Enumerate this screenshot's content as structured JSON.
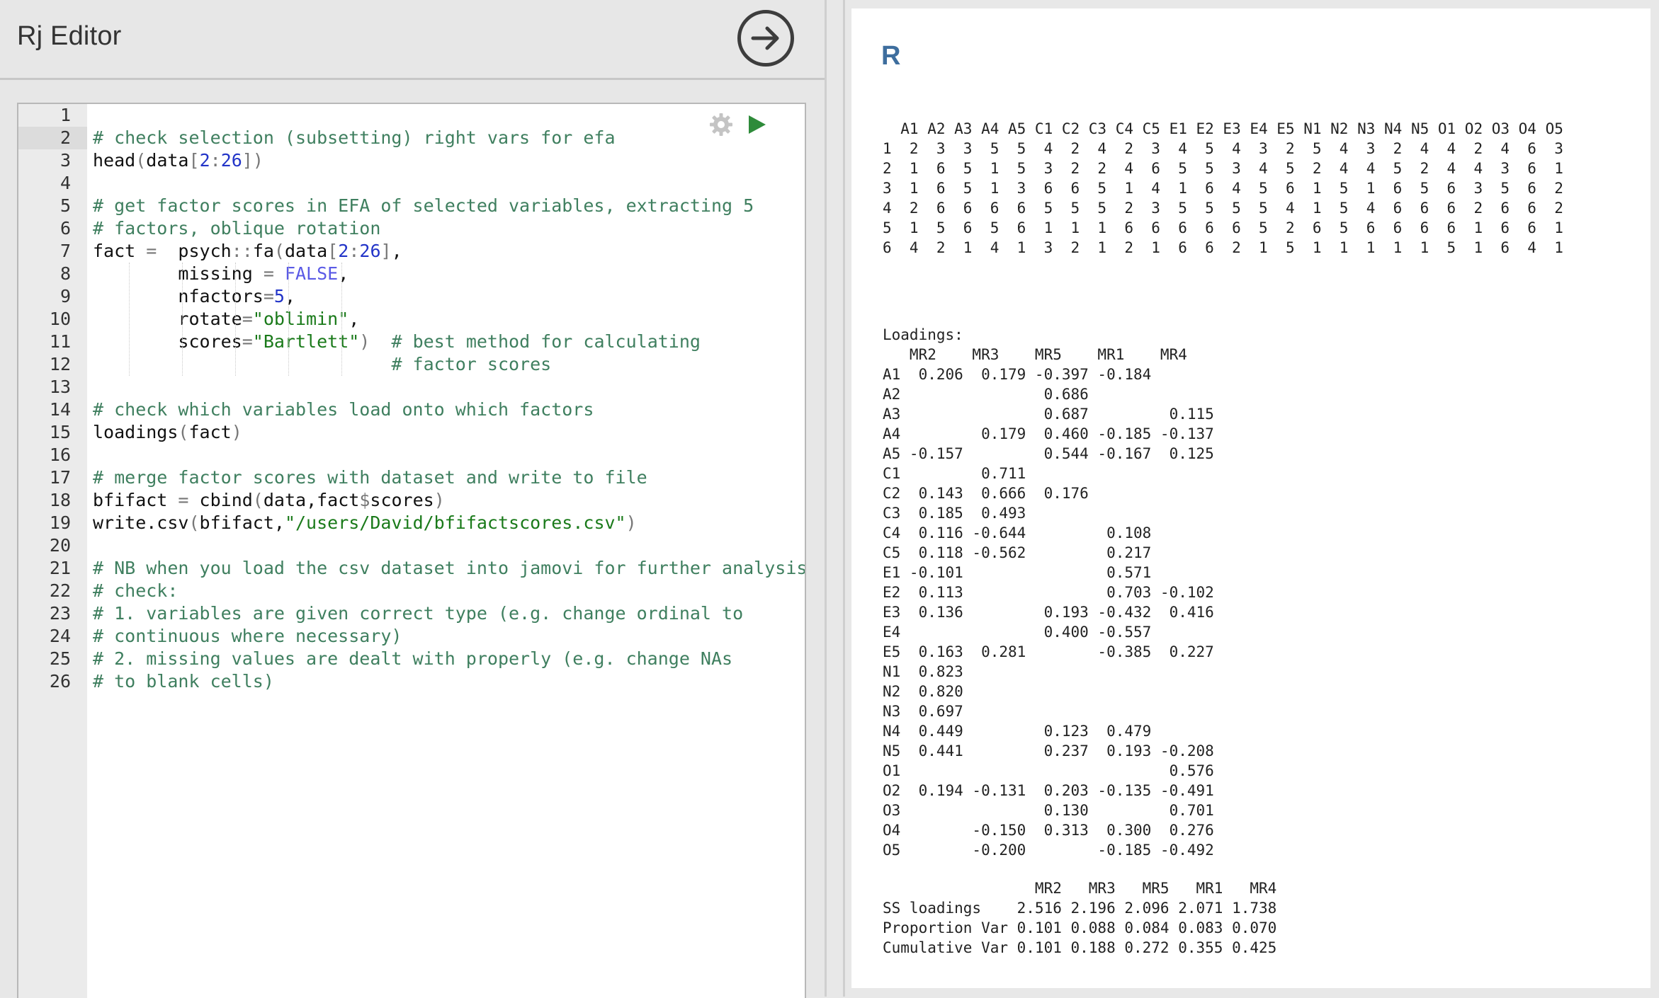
{
  "editor": {
    "title": "Rj Editor",
    "run_button_icon": "arrow-right-circle-icon",
    "toolbar": {
      "settings_icon": "gear-icon",
      "run_icon": "play-icon"
    },
    "active_line": 2,
    "lines": [
      "",
      "# check selection (subsetting) right vars for efa",
      "head(data[2:26])",
      "",
      "# get factor scores in EFA of selected variables, extracting 5",
      "# factors, oblique rotation",
      "fact =  psych::fa(data[2:26],",
      "        missing = FALSE,",
      "        nfactors=5,",
      "        rotate=\"oblimin\",",
      "        scores=\"Bartlett\")  # best method for calculating",
      "                            # factor scores",
      "",
      "# check which variables load onto which factors",
      "loadings(fact)",
      "",
      "# merge factor scores with dataset and write to file",
      "bfifact = cbind(data,fact$scores)",
      "write.csv(bfifact,\"/users/David/bfifactscores.csv\")",
      "",
      "# NB when you load the csv dataset into jamovi for further analysis,",
      "# check:",
      "# 1. variables are given correct type (e.g. change ordinal to",
      "# continuous where necessary)",
      "# 2. missing values are dealt with properly (e.g. change NAs",
      "# to blank cells)"
    ]
  },
  "results": {
    "heading": "R",
    "head_output": "  A1 A2 A3 A4 A5 C1 C2 C3 C4 C5 E1 E2 E3 E4 E5 N1 N2 N3 N4 N5 O1 O2 O3 O4 O5\n1  2  3  3  5  5  4  2  4  2  3  4  5  4  3  2  5  4  3  2  4  4  2  4  6  3\n2  1  6  5  1  5  3  2  2  4  6  5  5  3  4  5  2  4  4  5  2  4  4  3  6  1\n3  1  6  5  1  3  6  6  5  1  4  1  6  4  5  6  1  5  1  6  5  6  3  5  6  2\n4  2  6  6  6  6  5  5  5  2  3  5  5  5  5  4  1  5  4  6  6  6  2  6  6  2\n5  1  5  6  5  6  1  1  1  6  6  6  6  6  5  2  6  5  6  6  6  6  1  6  6  1\n6  4  2  1  4  1  3  2  1  2  1  6  6  2  1  5  1  1  1  1  1  5  1  6  4  1",
    "loadings_output": "Loadings:\n   MR2    MR3    MR5    MR1    MR4   \nA1  0.206  0.179 -0.397 -0.184       \nA2                0.686              \nA3                0.687         0.115\nA4         0.179  0.460 -0.185 -0.137\nA5 -0.157         0.544 -0.167  0.125\nC1         0.711                     \nC2  0.143  0.666  0.176              \nC3  0.185  0.493                     \nC4  0.116 -0.644         0.108       \nC5  0.118 -0.562         0.217       \nE1 -0.101                0.571       \nE2  0.113                0.703 -0.102\nE3  0.136         0.193 -0.432  0.416\nE4                0.400 -0.557       \nE5  0.163  0.281        -0.385  0.227\nN1  0.823                            \nN2  0.820                            \nN3  0.697                            \nN4  0.449         0.123  0.479       \nN5  0.441         0.237  0.193 -0.208\nO1                              0.576\nO2  0.194 -0.131  0.203 -0.135 -0.491\nO3                0.130         0.701\nO4        -0.150  0.313  0.300  0.276\nO5        -0.200        -0.185 -0.492",
    "variance_output": "                 MR2   MR3   MR5   MR1   MR4\nSS loadings    2.516 2.196 2.096 2.071 1.738\nProportion Var 0.101 0.088 0.084 0.083 0.070\nCumulative Var 0.101 0.188 0.272 0.355 0.425"
  }
}
